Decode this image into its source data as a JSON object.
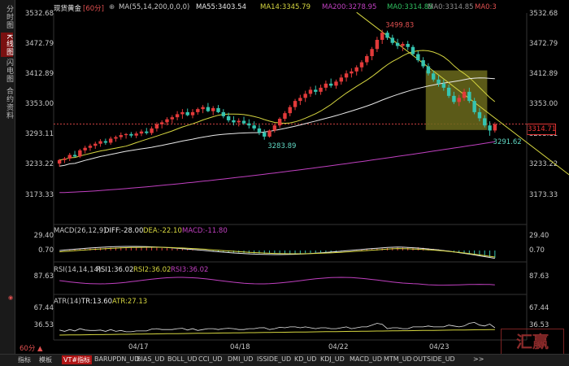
{
  "header": {
    "title": "现货黄金",
    "period": "[60分]",
    "ma_settings": "MA(55,14,200,0,0,0)",
    "ma55": "MA55:3403.54",
    "ma14": "MA14:3345.79",
    "ma200": "MA200:3278.95",
    "ma0a": "MA0:3314.85",
    "ma0b": "MA0:3314.85",
    "ma0c": "MA0:3"
  },
  "sidebar": {
    "tabs": [
      "分时图",
      "K线图",
      "闪电图",
      "合约资料"
    ]
  },
  "price_axis": {
    "labels": [
      "3532.68",
      "3472.79",
      "3412.89",
      "3353.00",
      "3293.11",
      "3233.22",
      "3173.33"
    ],
    "current_price": "3314.71"
  },
  "macd": {
    "header": "MACD(26,12,9)",
    "diff": "DIFF:-28.00",
    "dea": "DEA:-22.10",
    "macd": "MACD:-11.80",
    "axis": [
      "29.40",
      "0.70"
    ]
  },
  "rsi": {
    "header": "RSI(14,14,14)",
    "rsi1": "RSI1:36.02",
    "rsi2": "RSI2:36.02",
    "rsi3": "RSI3:36.02",
    "axis": [
      "87.63"
    ]
  },
  "atr": {
    "header": "ATR(14)",
    "tr": "TR:13.60",
    "atr": "ATR:27.13",
    "axis": [
      "67.44",
      "36.53"
    ]
  },
  "dates": [
    "04/17",
    "04/18",
    "04/22",
    "04/23"
  ],
  "period_label": "60分 ▲",
  "bottom_bar": {
    "items": [
      "指标",
      "模板",
      "VT#指标",
      "BARUPDN_UD",
      "BIAS_UD",
      "BOLL_UD",
      "CCI_UD",
      "DMI_UD",
      "ISSIDE_UD",
      "KD_UD",
      "KDJ_UD",
      "MACD_UD",
      "MTM_UD",
      "OUTSIDE_UD",
      ">>"
    ]
  },
  "watermark": "汇赢",
  "colors": {
    "up": "#e23a3a",
    "down": "#35c4b0",
    "ma14": "#d6d640",
    "ma55": "#e8e8e8",
    "ma200": "#c040c0",
    "trendline": "#d6d640",
    "box_fill": "#6b6a1c",
    "macd_diff": "#e8e8e8",
    "macd_dea": "#d6d640",
    "macd_bar": "#35c4b0",
    "rsi": "#c040c0",
    "atr_tr": "#e8e8e8",
    "atr_line": "#d6d640"
  },
  "chart_data": {
    "type": "candlestick",
    "ylim": [
      3173.33,
      3532.68
    ],
    "candles": [
      [
        3237,
        3246,
        3231,
        3244
      ],
      [
        3244,
        3250,
        3238,
        3247
      ],
      [
        3247,
        3258,
        3242,
        3254
      ],
      [
        3254,
        3262,
        3249,
        3251
      ],
      [
        3251,
        3266,
        3248,
        3263
      ],
      [
        3263,
        3272,
        3257,
        3268
      ],
      [
        3268,
        3276,
        3262,
        3272
      ],
      [
        3272,
        3280,
        3266,
        3276
      ],
      [
        3276,
        3285,
        3270,
        3281
      ],
      [
        3281,
        3286,
        3274,
        3278
      ],
      [
        3278,
        3290,
        3274,
        3286
      ],
      [
        3286,
        3292,
        3280,
        3289
      ],
      [
        3289,
        3298,
        3284,
        3293
      ],
      [
        3293,
        3297,
        3286,
        3295
      ],
      [
        3295,
        3299,
        3288,
        3292
      ],
      [
        3292,
        3300,
        3287,
        3296
      ],
      [
        3296,
        3304,
        3291,
        3300
      ],
      [
        3300,
        3307,
        3294,
        3297
      ],
      [
        3297,
        3310,
        3293,
        3306
      ],
      [
        3306,
        3318,
        3300,
        3314
      ],
      [
        3314,
        3322,
        3306,
        3318
      ],
      [
        3318,
        3328,
        3312,
        3324
      ],
      [
        3324,
        3332,
        3316,
        3328
      ],
      [
        3328,
        3340,
        3322,
        3334
      ],
      [
        3334,
        3344,
        3325,
        3338
      ],
      [
        3338,
        3345,
        3330,
        3332
      ],
      [
        3332,
        3344,
        3326,
        3338
      ],
      [
        3338,
        3347,
        3333,
        3344
      ],
      [
        3344,
        3352,
        3336,
        3348
      ],
      [
        3348,
        3356,
        3338,
        3340
      ],
      [
        3340,
        3350,
        3332,
        3346
      ],
      [
        3346,
        3352,
        3336,
        3338
      ],
      [
        3338,
        3344,
        3326,
        3330
      ],
      [
        3330,
        3337,
        3318,
        3322
      ],
      [
        3322,
        3330,
        3312,
        3318
      ],
      [
        3318,
        3326,
        3310,
        3321
      ],
      [
        3321,
        3329,
        3313,
        3316
      ],
      [
        3316,
        3324,
        3306,
        3312
      ],
      [
        3312,
        3320,
        3302,
        3306
      ],
      [
        3306,
        3313,
        3293,
        3298
      ],
      [
        3298,
        3304,
        3283.89,
        3290
      ],
      [
        3290,
        3304,
        3288,
        3302
      ],
      [
        3302,
        3316,
        3298,
        3312
      ],
      [
        3312,
        3328,
        3307,
        3325
      ],
      [
        3325,
        3340,
        3320,
        3336
      ],
      [
        3336,
        3352,
        3330,
        3348
      ],
      [
        3348,
        3364,
        3342,
        3360
      ],
      [
        3360,
        3372,
        3352,
        3366
      ],
      [
        3366,
        3380,
        3358,
        3374
      ],
      [
        3374,
        3388,
        3368,
        3382
      ],
      [
        3382,
        3390,
        3372,
        3378
      ],
      [
        3378,
        3392,
        3372,
        3386
      ],
      [
        3386,
        3400,
        3380,
        3394
      ],
      [
        3394,
        3404,
        3386,
        3390
      ],
      [
        3390,
        3402,
        3384,
        3398
      ],
      [
        3398,
        3412,
        3392,
        3406
      ],
      [
        3406,
        3420,
        3398,
        3414
      ],
      [
        3414,
        3424,
        3406,
        3418
      ],
      [
        3418,
        3430,
        3410,
        3426
      ],
      [
        3426,
        3440,
        3418,
        3436
      ],
      [
        3436,
        3452,
        3430,
        3448
      ],
      [
        3448,
        3466,
        3440,
        3462
      ],
      [
        3462,
        3486,
        3456,
        3480
      ],
      [
        3480,
        3499.83,
        3472,
        3494
      ],
      [
        3494,
        3498,
        3480,
        3484
      ],
      [
        3484,
        3490,
        3470,
        3474
      ],
      [
        3474,
        3482,
        3462,
        3468
      ],
      [
        3468,
        3476,
        3458,
        3472
      ],
      [
        3472,
        3478,
        3460,
        3466
      ],
      [
        3466,
        3470,
        3448,
        3452
      ],
      [
        3452,
        3458,
        3436,
        3440
      ],
      [
        3440,
        3446,
        3424,
        3428
      ],
      [
        3428,
        3434,
        3410,
        3414
      ],
      [
        3414,
        3420,
        3398,
        3402
      ],
      [
        3402,
        3410,
        3388,
        3394
      ],
      [
        3394,
        3402,
        3380,
        3386
      ],
      [
        3386,
        3392,
        3366,
        3370
      ],
      [
        3370,
        3378,
        3354,
        3358
      ],
      [
        3358,
        3372,
        3350,
        3366
      ],
      [
        3366,
        3384,
        3360,
        3378
      ],
      [
        3378,
        3386,
        3356,
        3360
      ],
      [
        3360,
        3366,
        3334,
        3338
      ],
      [
        3338,
        3346,
        3320,
        3326
      ],
      [
        3326,
        3332,
        3308,
        3312
      ],
      [
        3312,
        3320,
        3291.62,
        3302
      ],
      [
        3302,
        3318,
        3298,
        3314
      ]
    ],
    "annotations": [
      {
        "label": "3499.83",
        "candle": 63,
        "price": 3499.83,
        "pos": "top"
      },
      {
        "label": "3283.89",
        "candle": 40,
        "price": 3283.89,
        "pos": "bottom"
      },
      {
        "label": "3291.62",
        "candle": 84,
        "price": 3291.62,
        "pos": "bottom"
      }
    ],
    "current_price": 3314.71,
    "highlight_box": {
      "from_candle": 72,
      "to_candle": 83,
      "low": 3303,
      "high": 3420
    },
    "trendline": {
      "from_candle": 58,
      "from_price": 3534,
      "to_candle": 106,
      "to_price": 3165
    },
    "macd_axis": [
      0.7,
      29.4
    ],
    "rsi_axis": [
      87.63
    ],
    "atr_axis": [
      36.53,
      67.44
    ],
    "date_labels": [
      {
        "label": "04/17",
        "candle": 14
      },
      {
        "label": "04/18",
        "candle": 33
      },
      {
        "label": "04/22",
        "candle": 54
      },
      {
        "label": "04/23",
        "candle": 73
      }
    ]
  }
}
